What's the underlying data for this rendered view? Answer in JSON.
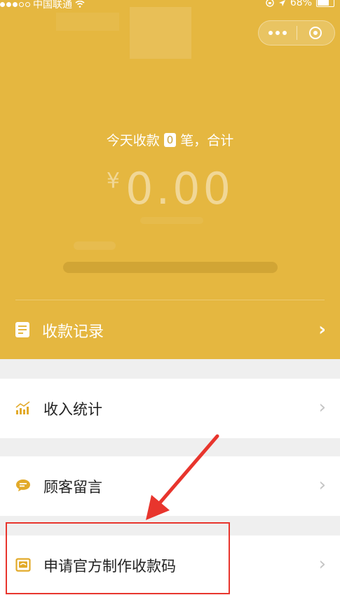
{
  "status_bar": {
    "carrier": "中国联通",
    "battery": "68%"
  },
  "header": {
    "today_prefix": "今天收款",
    "today_count": "0",
    "today_suffix": "笔，合计",
    "currency": "¥",
    "amount": "0.00",
    "record_label": "收款记录"
  },
  "menu": {
    "income_stats": "收入统计",
    "customer_messages": "顾客留言",
    "apply_qr": "申请官方制作收款码"
  },
  "colors": {
    "brand": "#e5b740",
    "annotation": "#e8352d",
    "icon": "#e2aa2a"
  }
}
